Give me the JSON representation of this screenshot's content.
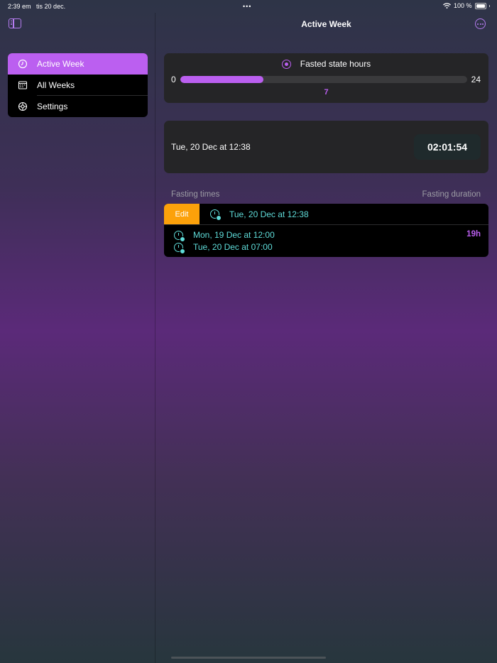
{
  "status_bar": {
    "time": "2:39 em",
    "date": "tis 20 dec.",
    "battery": "100 %"
  },
  "navigation": {
    "title": "Active Week"
  },
  "sidebar": {
    "items": [
      {
        "label": "Active Week",
        "icon": "clock-icon",
        "selected": true
      },
      {
        "label": "All Weeks",
        "icon": "calendar-icon",
        "selected": false
      },
      {
        "label": "Settings",
        "icon": "gear-icon",
        "selected": false
      }
    ]
  },
  "fasted_state": {
    "title": "Fasted state hours",
    "min": "0",
    "max": "24",
    "value": "7",
    "progress_fraction": 0.29
  },
  "current_fast": {
    "start": "Tue, 20 Dec at 12:38",
    "elapsed": "02:01:54"
  },
  "fasting_list": {
    "header_left": "Fasting times",
    "header_right": "Fasting duration",
    "edit_label": "Edit",
    "active_start": "Tue, 20 Dec at 12:38",
    "entries": [
      {
        "start": "Mon, 19 Dec at 12:00",
        "end": "Tue, 20 Dec at 07:00",
        "duration": "19h"
      }
    ]
  },
  "colors": {
    "accent": "#bb5ff0",
    "teal": "#5fdcd9",
    "edit": "#fca10a"
  }
}
